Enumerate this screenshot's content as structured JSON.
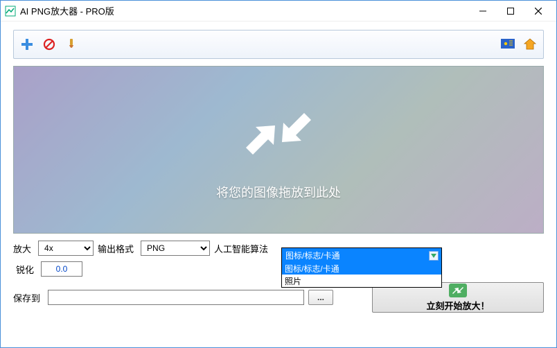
{
  "window": {
    "title": "AI PNG放大器 - PRO版"
  },
  "toolbar": {
    "add_name": "add-icon",
    "forbid_name": "forbid-icon",
    "brush_name": "brush-icon",
    "flag_name": "flag-icon",
    "home_name": "home-icon"
  },
  "dropzone": {
    "hint": "将您的图像拖放到此处"
  },
  "controls": {
    "enlarge_label": "放大",
    "enlarge_value": "4x",
    "format_label": "输出格式",
    "format_value": "PNG",
    "algo_label": "人工智能算法",
    "algo_selected": "图标/标志/卡通",
    "algo_options": [
      "图标/标志/卡通",
      "照片"
    ],
    "sharpen_label": "锐化",
    "sharpen_value": "0.0",
    "saveto_label": "保存到",
    "saveto_value": "",
    "browse_label": "...",
    "start_label": "立刻开始放大！"
  }
}
